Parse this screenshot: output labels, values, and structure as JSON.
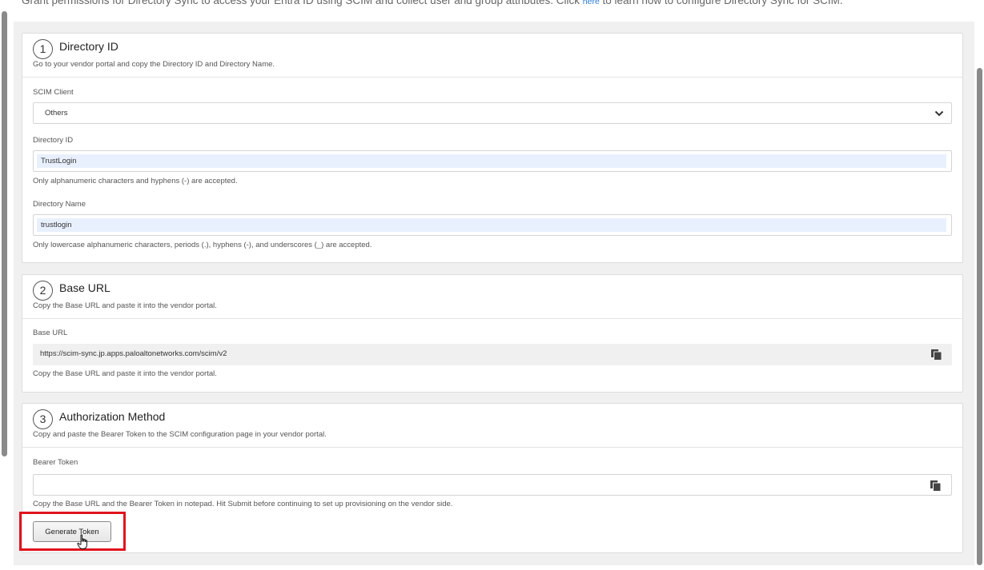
{
  "intro": {
    "text_before": "Grant permissions for Directory Sync to access your Entra ID using SCIM and collect user and group attributes. Click ",
    "link": "here",
    "text_after": " to learn how to configure Directory Sync for SCIM."
  },
  "step1": {
    "number": "1",
    "title": "Directory ID",
    "description": "Go to your vendor portal and copy the Directory ID and Directory Name.",
    "scim_client_label": "SCIM Client",
    "scim_client_value": "Others",
    "directory_id_label": "Directory ID",
    "directory_id_value": "TrustLogin",
    "directory_id_hint": "Only alphanumeric characters and hyphens (-) are accepted.",
    "directory_name_label": "Directory Name",
    "directory_name_value": "trustlogin",
    "directory_name_hint": "Only lowercase alphanumeric characters, periods (.), hyphens (-), and underscores (_) are accepted."
  },
  "step2": {
    "number": "2",
    "title": "Base URL",
    "description": "Copy the Base URL and paste it into the vendor portal.",
    "base_url_label": "Base URL",
    "base_url_value": "https://scim-sync.jp.apps.paloaltonetworks.com/scim/v2",
    "base_url_hint": "Copy the Base URL and paste it into the vendor portal."
  },
  "step3": {
    "number": "3",
    "title": "Authorization Method",
    "description": "Copy and paste the Bearer Token to the SCIM configuration page in your vendor portal.",
    "bearer_label": "Bearer Token",
    "bearer_value": "",
    "bearer_hint": "Copy the Base URL and the Bearer Token in notepad. Hit Submit before continuing to set up provisioning on the vendor side.",
    "generate_button": "Generate Token"
  },
  "icons": {
    "select_chevron": "chevron-down-icon",
    "copy": "copy-icon",
    "cursor": "hand-pointer-icon"
  },
  "colors": {
    "highlight": "#e0141e",
    "link": "#2a7bd4",
    "autofill": "#e9f0fd"
  }
}
